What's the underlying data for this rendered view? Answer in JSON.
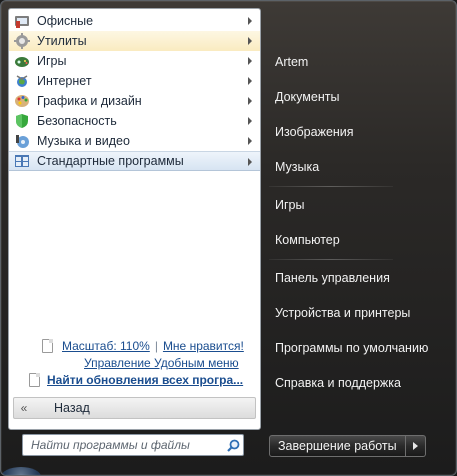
{
  "menu": {
    "items": [
      {
        "label": "Офисные",
        "icon": "office-icon"
      },
      {
        "label": "Утилиты",
        "icon": "utilities-gear-icon"
      },
      {
        "label": "Игры",
        "icon": "games-gamepad-icon"
      },
      {
        "label": "Интернет",
        "icon": "internet-globe-icon"
      },
      {
        "label": "Графика и дизайн",
        "icon": "graphics-palette-icon"
      },
      {
        "label": "Безопасность",
        "icon": "security-shield-icon"
      },
      {
        "label": "Музыка и видео",
        "icon": "music-note-icon"
      },
      {
        "label": "Стандартные программы",
        "icon": "standard-programs-icon"
      }
    ]
  },
  "links": {
    "scale": "Масштаб: 110%",
    "like": "Мне нравится!",
    "manage": "Управление Удобным меню",
    "updates": "Найти обновления всех програ..."
  },
  "back": {
    "label": "Назад",
    "arrows": "«"
  },
  "search": {
    "placeholder": "Найти программы и файлы"
  },
  "right": {
    "items": [
      "Artem",
      "Документы",
      "Изображения",
      "Музыка",
      "Игры",
      "Компьютер",
      "Панель управления",
      "Устройства и принтеры",
      "Программы по умолчанию",
      "Справка и поддержка"
    ]
  },
  "shutdown": {
    "label": "Завершение работы"
  },
  "colors": {
    "hover_item": "#faebc0",
    "link": "#1a4d8f",
    "right_text": "#f2f2f2"
  }
}
